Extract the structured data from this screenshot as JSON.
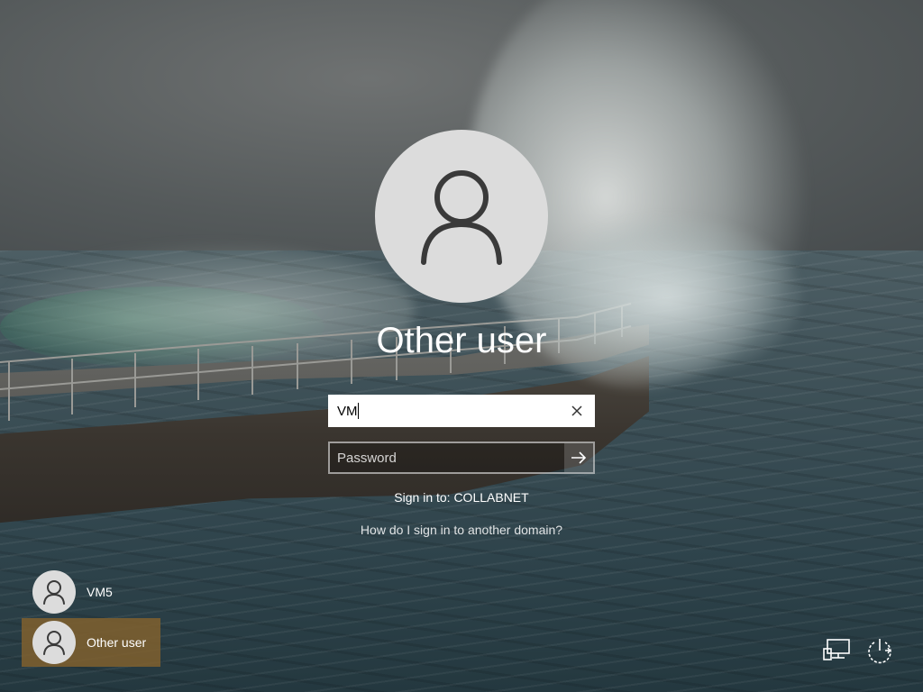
{
  "login": {
    "title": "Other user",
    "username_value": "VM",
    "password_placeholder": "Password",
    "sign_in_to": "Sign in to: COLLABNET",
    "other_domain_link": "How do I sign in to another domain?"
  },
  "user_list": [
    {
      "name": "VM5",
      "selected": false
    },
    {
      "name": "Other user",
      "selected": true
    }
  ],
  "icons": {
    "avatar": "user-icon",
    "clear": "close-icon",
    "submit": "arrow-right-icon",
    "network": "network-icon",
    "power": "power-icon"
  },
  "colors": {
    "selected_user_bg": "#80602e",
    "avatar_bg": "#dcdcdc"
  }
}
